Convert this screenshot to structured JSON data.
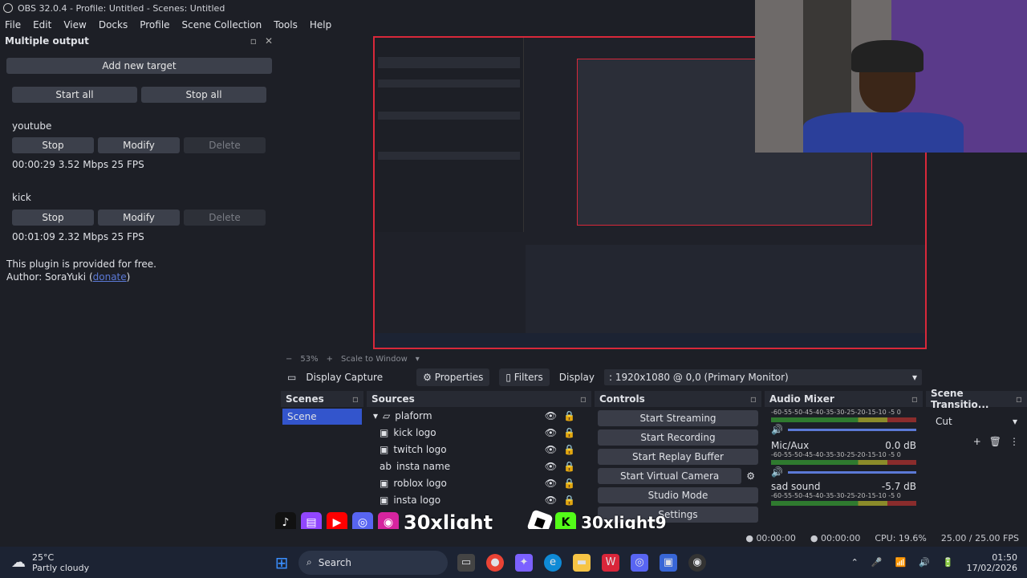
{
  "window": {
    "title": "OBS 32.0.4 - Profile: Untitled - Scenes: Untitled"
  },
  "menu": [
    "File",
    "Edit",
    "View",
    "Docks",
    "Profile",
    "Scene Collection",
    "Tools",
    "Help"
  ],
  "multi_output": {
    "title": "Multiple output",
    "add_target": "Add new target",
    "start_all": "Start all",
    "stop_all": "Stop all",
    "targets": [
      {
        "name": "youtube",
        "stop": "Stop",
        "modify": "Modify",
        "delete": "Delete",
        "stats": "00:00:29  3.52 Mbps  25 FPS"
      },
      {
        "name": "kick",
        "stop": "Stop",
        "modify": "Modify",
        "delete": "Delete",
        "stats": "00:01:09  2.32 Mbps  25 FPS"
      }
    ],
    "note1": "This plugin is provided for free.",
    "note2": "Author: SoraYuki (",
    "donate": "donate",
    "note3": ")"
  },
  "zoom": {
    "percent": "53%",
    "mode": "Scale to Window"
  },
  "toolbar": {
    "source": "Display Capture",
    "properties": "Properties",
    "filters": "Filters",
    "display_label": "Display",
    "display_value": ": 1920x1080 @ 0,0 (Primary Monitor)"
  },
  "scenes": {
    "title": "Scenes",
    "items": [
      "Scene"
    ]
  },
  "sources": {
    "title": "Sources",
    "group": "plaform",
    "items": [
      "kick logo",
      "twitch logo",
      "insta name",
      "roblox logo",
      "insta logo"
    ]
  },
  "controls": {
    "title": "Controls",
    "buttons": [
      "Start Streaming",
      "Start Recording",
      "Start Replay Buffer",
      "Start Virtual Camera",
      "Studio Mode",
      "Settings"
    ]
  },
  "audio": {
    "title": "Audio Mixer",
    "scale": "-60-55-50-45-40-35-30-25-20-15-10 -5  0",
    "channels": [
      {
        "name": "",
        "db": ""
      },
      {
        "name": "Mic/Aux",
        "db": "0.0 dB"
      },
      {
        "name": "sad sound",
        "db": "-5.7 dB"
      }
    ]
  },
  "transitions": {
    "title": "Scene Transitio...",
    "value": "Cut"
  },
  "status": {
    "rec_time": "00:00:00",
    "stream_time": "00:00:00",
    "cpu": "CPU: 19.6%",
    "fps": "25.00 / 25.00 FPS"
  },
  "overlay": {
    "brand1": "30xlight",
    "brand2": "30xlight9"
  },
  "taskbar": {
    "weather_temp": "25°C",
    "weather_desc": "Partly cloudy",
    "search": "Search",
    "time": "01:50",
    "date": "17/02/2026"
  },
  "colors": {
    "accent": "#3355cc",
    "red_border": "#d8283a",
    "bg": "#1d1f26"
  }
}
